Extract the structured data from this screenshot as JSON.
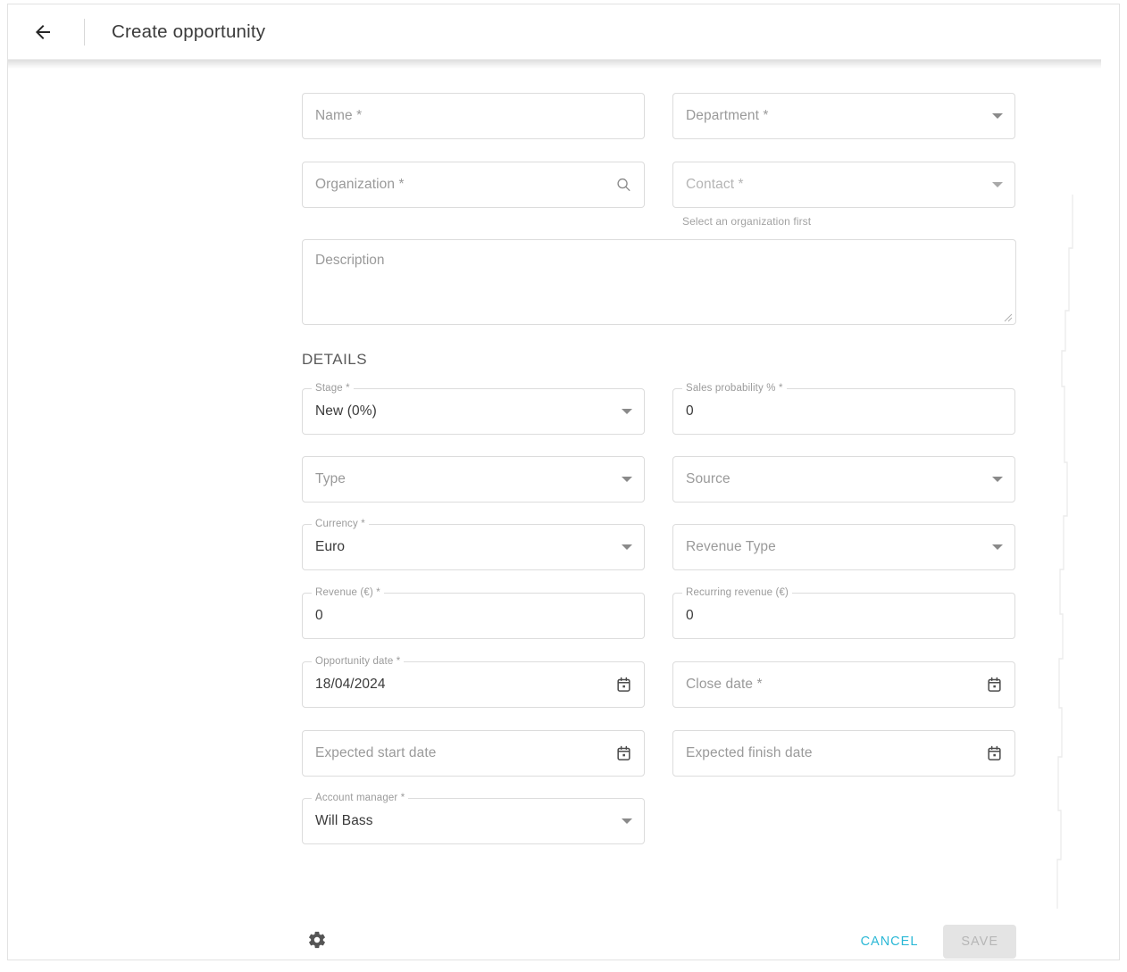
{
  "header": {
    "back_icon": "arrow-left-icon",
    "title": "Create opportunity"
  },
  "form": {
    "fields": {
      "name": {
        "placeholder": "Name *"
      },
      "department": {
        "placeholder": "Department *",
        "icon": "chevron-down-icon"
      },
      "organization": {
        "placeholder": "Organization *",
        "icon": "search-icon"
      },
      "contact": {
        "placeholder": "Contact *",
        "icon": "chevron-down-icon",
        "helper": "Select an organization first"
      },
      "description": {
        "placeholder": "Description"
      }
    },
    "details_title": "DETAILS",
    "details": {
      "stage": {
        "label": "Stage *",
        "value": "New (0%)",
        "icon": "chevron-down-icon"
      },
      "sales_probability": {
        "label": "Sales probability % *",
        "value": "0"
      },
      "type": {
        "placeholder": "Type",
        "icon": "chevron-down-icon"
      },
      "source": {
        "placeholder": "Source",
        "icon": "chevron-down-icon"
      },
      "currency": {
        "label": "Currency *",
        "value": "Euro",
        "icon": "chevron-down-icon"
      },
      "revenue_type": {
        "placeholder": "Revenue Type",
        "icon": "chevron-down-icon"
      },
      "revenue": {
        "label": "Revenue (€) *",
        "value": "0"
      },
      "recurring_revenue": {
        "label": "Recurring revenue (€)",
        "value": "0"
      },
      "opportunity_date": {
        "label": "Opportunity date *",
        "value": "18/04/2024",
        "icon": "calendar-icon"
      },
      "close_date": {
        "placeholder": "Close date *",
        "icon": "calendar-icon"
      },
      "expected_start_date": {
        "placeholder": "Expected start date",
        "icon": "calendar-icon"
      },
      "expected_finish_date": {
        "placeholder": "Expected finish date",
        "icon": "calendar-icon"
      },
      "account_manager": {
        "label": "Account manager *",
        "value": "Will Bass",
        "icon": "chevron-down-icon"
      }
    }
  },
  "footer": {
    "settings_icon": "gear-icon",
    "cancel_label": "CANCEL",
    "save_label": "SAVE"
  },
  "colors": {
    "accent": "#2bb8d6",
    "text": "#3a3a3a",
    "placeholder": "#9a9a9a",
    "border": "#dcdcdc",
    "save_disabled_bg": "#e4e4e4",
    "save_disabled_text": "#b6b6b6"
  }
}
